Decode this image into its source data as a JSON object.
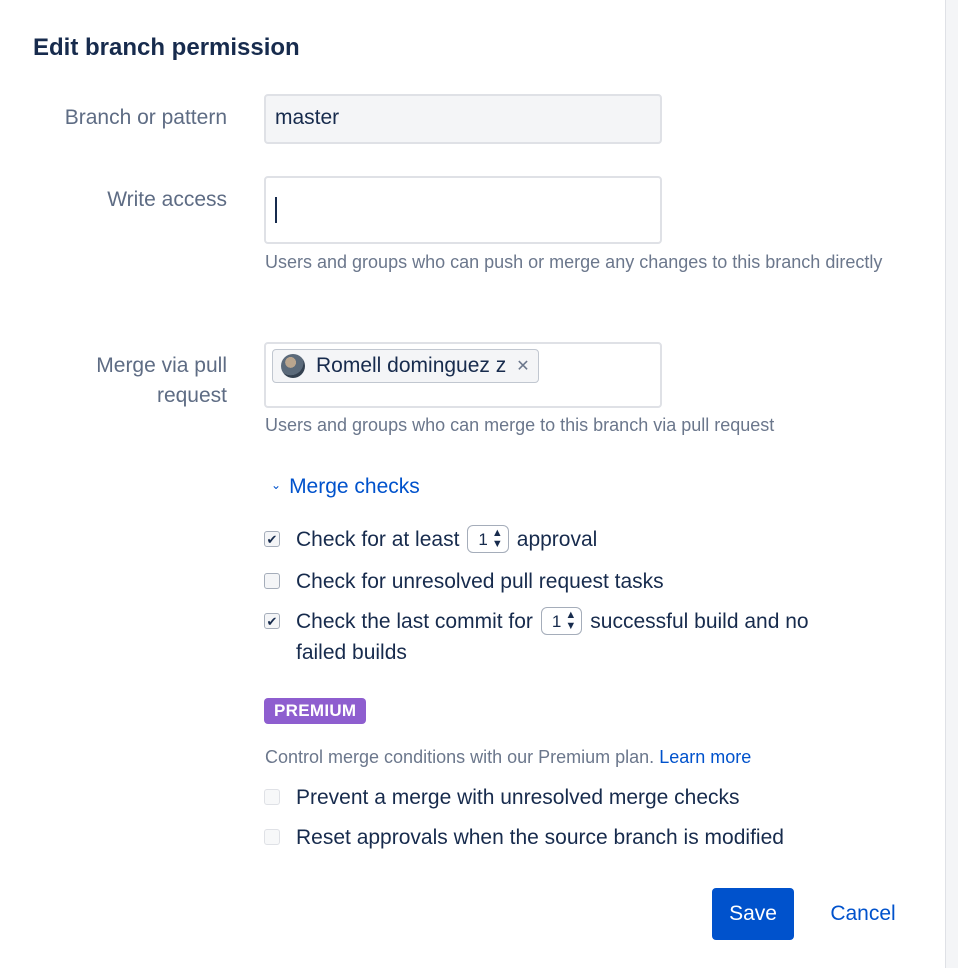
{
  "dialog": {
    "title": "Edit branch permission"
  },
  "branch_field": {
    "label": "Branch or pattern",
    "value": "master"
  },
  "write_access": {
    "label": "Write access",
    "value": "",
    "help": "Users and groups who can push or merge any changes to this branch directly"
  },
  "merge_pr": {
    "label_line1": "Merge via pull",
    "label_line2": "request",
    "tags": [
      {
        "name": "Romell dominguez z",
        "remove_glyph": "✕"
      }
    ],
    "help": "Users and groups who can merge to this branch via pull request"
  },
  "merge_checks": {
    "toggle_label": "Merge checks",
    "toggle_icon": "chevron-down-icon",
    "items": [
      {
        "checked": true,
        "before": "Check for at least",
        "select_value": "1",
        "after": "approval"
      },
      {
        "checked": false,
        "text": "Check for unresolved pull request tasks"
      },
      {
        "checked": true,
        "before": "Check the last commit for",
        "select_value": "1",
        "after_line1": "successful build and no",
        "after_line2": "failed builds"
      }
    ]
  },
  "premium": {
    "badge": "PREMIUM",
    "badge_color": "#8e5ecf",
    "description": "Control merge conditions with our Premium plan.",
    "learn_more": "Learn more",
    "items": [
      {
        "checked": false,
        "disabled": true,
        "text": "Prevent a merge with unresolved merge checks"
      },
      {
        "checked": false,
        "disabled": true,
        "text": "Reset approvals when the source branch is modified"
      }
    ]
  },
  "actions": {
    "save_label": "Save",
    "cancel_label": "Cancel",
    "primary_color": "#0052cc"
  }
}
